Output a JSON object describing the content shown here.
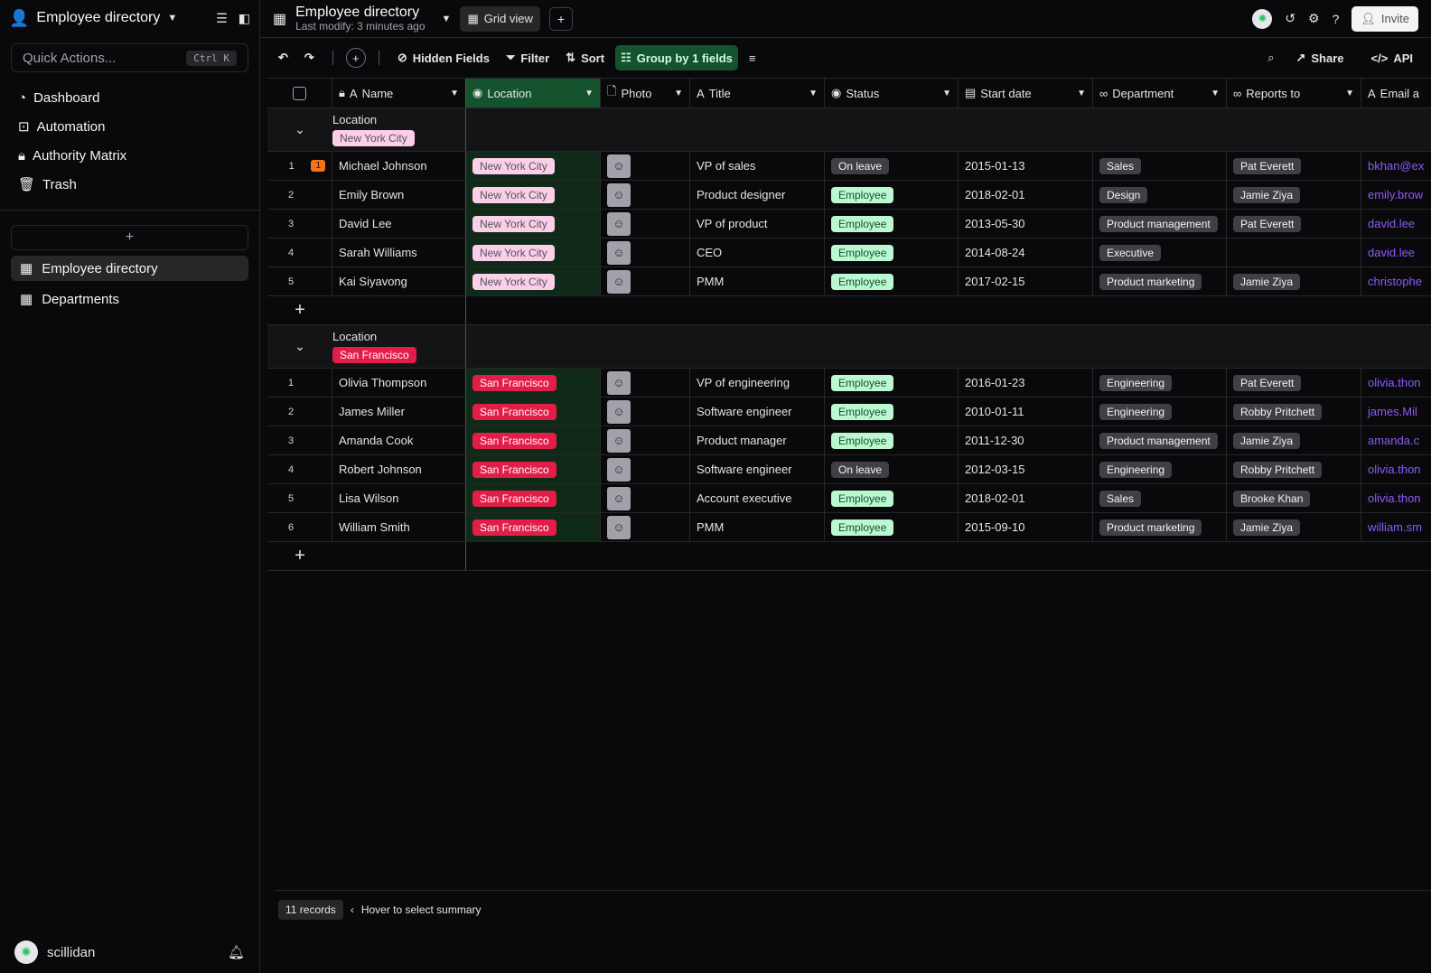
{
  "sidebar": {
    "base_title": "Employee directory",
    "quick_actions": {
      "placeholder": "Quick Actions...",
      "shortcut": "Ctrl K"
    },
    "nav": [
      {
        "label": "Dashboard",
        "icon": "gauge-icon"
      },
      {
        "label": "Automation",
        "icon": "robot-icon"
      },
      {
        "label": "Authority Matrix",
        "icon": "lock-icon"
      },
      {
        "label": "Trash",
        "icon": "trash-icon"
      }
    ],
    "add_label": "+",
    "tables": [
      {
        "label": "Employee directory",
        "active": true
      },
      {
        "label": "Departments",
        "active": false
      }
    ],
    "user": "scillidan"
  },
  "topbar": {
    "title": "Employee directory",
    "subtitle": "Last modify: 3 minutes ago",
    "view_label": "Grid view",
    "invite_label": "Invite"
  },
  "toolbar": {
    "hidden_fields": "Hidden Fields",
    "filter": "Filter",
    "sort": "Sort",
    "group": "Group by 1 fields",
    "share": "Share",
    "api": "API"
  },
  "columns": [
    "Name",
    "Location",
    "Photo",
    "Title",
    "Status",
    "Start date",
    "Department",
    "Reports to",
    "Email a"
  ],
  "groups": [
    {
      "field_label": "Location",
      "value": "New York City",
      "rows": [
        {
          "num": "1",
          "comment": "1",
          "name": "Michael Johnson",
          "location": "New York City",
          "title": "VP of sales",
          "status": "On leave",
          "start": "2015-01-13",
          "dept": "Sales",
          "reports": "Pat Everett",
          "email": "bkhan@ex"
        },
        {
          "num": "2",
          "comment": "",
          "name": "Emily Brown",
          "location": "New York City",
          "title": "Product designer",
          "status": "Employee",
          "start": "2018-02-01",
          "dept": "Design",
          "reports": "Jamie Ziya",
          "email": "emily.brow"
        },
        {
          "num": "3",
          "comment": "",
          "name": "David Lee",
          "location": "New York City",
          "title": "VP of product",
          "status": "Employee",
          "start": "2013-05-30",
          "dept": "Product management",
          "reports": "Pat Everett",
          "email": "david.lee"
        },
        {
          "num": "4",
          "comment": "",
          "name": "Sarah Williams",
          "location": "New York City",
          "title": "CEO",
          "status": "Employee",
          "start": "2014-08-24",
          "dept": "Executive",
          "reports": "",
          "email": "david.lee"
        },
        {
          "num": "5",
          "comment": "",
          "name": "Kai Siyavong",
          "location": "New York City",
          "title": "PMM",
          "status": "Employee",
          "start": "2017-02-15",
          "dept": "Product marketing",
          "reports": "Jamie Ziya",
          "email": "christophe"
        }
      ]
    },
    {
      "field_label": "Location",
      "value": "San Francisco",
      "rows": [
        {
          "num": "1",
          "comment": "",
          "name": "Olivia Thompson",
          "location": "San Francisco",
          "title": "VP of engineering",
          "status": "Employee",
          "start": "2016-01-23",
          "dept": "Engineering",
          "reports": "Pat Everett",
          "email": "olivia.thon"
        },
        {
          "num": "2",
          "comment": "",
          "name": "James Miller",
          "location": "San Francisco",
          "title": "Software engineer",
          "status": "Employee",
          "start": "2010-01-11",
          "dept": "Engineering",
          "reports": "Robby Pritchett",
          "email": "james.Mil"
        },
        {
          "num": "3",
          "comment": "",
          "name": "Amanda Cook",
          "location": "San Francisco",
          "title": "Product manager",
          "status": "Employee",
          "start": "2011-12-30",
          "dept": "Product management",
          "reports": "Jamie Ziya",
          "email": "amanda.c"
        },
        {
          "num": "4",
          "comment": "",
          "name": "Robert Johnson",
          "location": "San Francisco",
          "title": "Software engineer",
          "status": "On leave",
          "start": "2012-03-15",
          "dept": "Engineering",
          "reports": "Robby Pritchett",
          "email": "olivia.thon"
        },
        {
          "num": "5",
          "comment": "",
          "name": "Lisa Wilson",
          "location": "San Francisco",
          "title": "Account executive",
          "status": "Employee",
          "start": "2018-02-01",
          "dept": "Sales",
          "reports": "Brooke Khan",
          "email": "olivia.thon"
        },
        {
          "num": "6",
          "comment": "",
          "name": "William Smith",
          "location": "San Francisco",
          "title": "PMM",
          "status": "Employee",
          "start": "2015-09-10",
          "dept": "Product marketing",
          "reports": "Jamie Ziya",
          "email": "william.sm"
        }
      ]
    }
  ],
  "footer": {
    "records": "11 records",
    "hint": "Hover to select summary"
  },
  "colors": {
    "accent": "#14532d",
    "ny_pill": "#fbcfe8",
    "sf_pill": "#e11d48",
    "employee_pill": "#bbf7d0",
    "link": "#8b5cf6"
  }
}
